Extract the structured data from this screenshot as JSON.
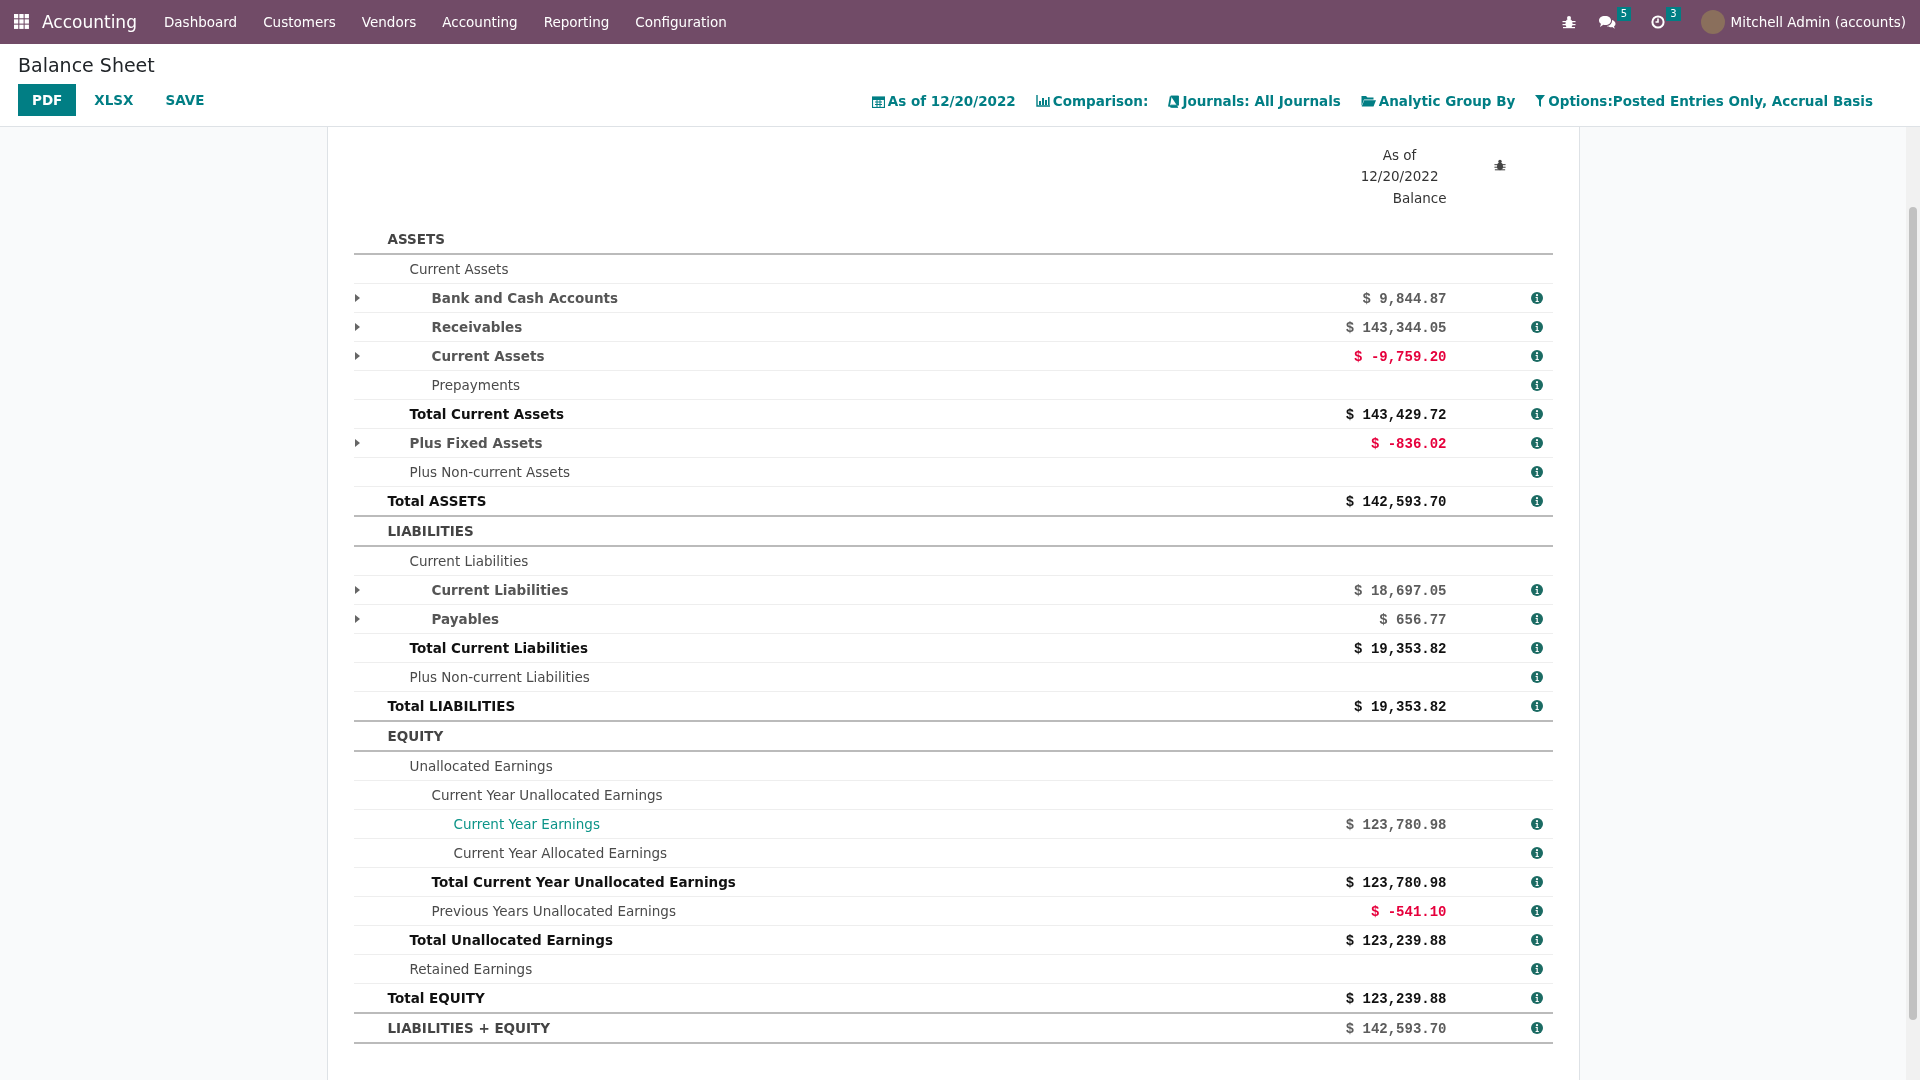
{
  "app": {
    "name": "Accounting"
  },
  "menu": [
    "Dashboard",
    "Customers",
    "Vendors",
    "Accounting",
    "Reporting",
    "Configuration"
  ],
  "systray": {
    "messages": "5",
    "activities": "3",
    "user": "Mitchell Admin (accounts)"
  },
  "page": {
    "title": "Balance Sheet"
  },
  "buttons": [
    {
      "label": "PDF",
      "kind": "primary"
    },
    {
      "label": "XLSX",
      "kind": "link"
    },
    {
      "label": "SAVE",
      "kind": "link"
    }
  ],
  "filters": [
    {
      "kind": "date",
      "label": "As of 12/20/2022"
    },
    {
      "kind": "comparison",
      "label": "Comparison:"
    },
    {
      "kind": "journals",
      "label": "Journals: All Journals"
    },
    {
      "kind": "analytic",
      "label": "Analytic Group By"
    },
    {
      "kind": "options",
      "label": "Options:Posted Entries Only, Accrual Basis"
    }
  ],
  "report": {
    "header": {
      "date": [
        "As of",
        "12/20/2022"
      ],
      "column": "Balance"
    },
    "lines": [
      {
        "kind": "section",
        "label": "ASSETS",
        "children": [
          {
            "kind": "group",
            "label": "Current Assets",
            "children": [
              {
                "kind": "account",
                "label": "Bank and Cash Accounts",
                "value": "$ 9,844.87",
                "negative": false
              },
              {
                "kind": "account",
                "label": "Receivables",
                "value": "$ 143,344.05",
                "negative": false
              },
              {
                "kind": "account",
                "label": "Current Assets",
                "value": "$ -9,759.20",
                "negative": true
              },
              {
                "kind": "line",
                "label": "Prepayments"
              }
            ]
          },
          {
            "kind": "total",
            "label": "Total Current Assets",
            "value": "$ 143,429.72",
            "negative": false
          },
          {
            "kind": "account",
            "label": "Plus Fixed Assets",
            "value": "$ -836.02",
            "negative": true
          },
          {
            "kind": "line",
            "label": "Plus Non-current Assets"
          }
        ]
      },
      {
        "kind": "grand",
        "label": "Total ASSETS",
        "value": "$ 142,593.70",
        "negative": false
      },
      {
        "kind": "section",
        "label": "LIABILITIES",
        "children": [
          {
            "kind": "group",
            "label": "Current Liabilities",
            "children": [
              {
                "kind": "account",
                "label": "Current Liabilities",
                "value": "$ 18,697.05",
                "negative": false
              },
              {
                "kind": "account",
                "label": "Payables",
                "value": "$ 656.77",
                "negative": false
              }
            ]
          },
          {
            "kind": "total",
            "label": "Total Current Liabilities",
            "value": "$ 19,353.82",
            "negative": false
          },
          {
            "kind": "line",
            "label": "Plus Non-current Liabilities"
          }
        ]
      },
      {
        "kind": "grand",
        "label": "Total LIABILITIES",
        "value": "$ 19,353.82",
        "negative": false
      },
      {
        "kind": "section",
        "label": "EQUITY",
        "children": [
          {
            "kind": "group",
            "label": "Unallocated Earnings",
            "children": [
              {
                "kind": "group",
                "label": "Current Year Unallocated Earnings",
                "children": [
                  {
                    "kind": "link",
                    "label": "Current Year Earnings",
                    "value": "$ 123,780.98",
                    "negative": false
                  },
                  {
                    "kind": "line",
                    "label": "Current Year Allocated Earnings"
                  }
                ]
              },
              {
                "kind": "total",
                "label": "Total Current Year Unallocated Earnings",
                "value": "$ 123,780.98",
                "negative": false
              },
              {
                "kind": "line",
                "label": "Previous Years Unallocated Earnings",
                "value": "$ -541.10",
                "negative": true
              }
            ]
          },
          {
            "kind": "total",
            "label": "Total Unallocated Earnings",
            "value": "$ 123,239.88",
            "negative": false
          },
          {
            "kind": "line",
            "label": "Retained Earnings"
          }
        ]
      },
      {
        "kind": "grand",
        "label": "Total EQUITY",
        "value": "$ 123,239.88",
        "negative": false
      },
      {
        "kind": "summary",
        "label": "LIABILITIES + EQUITY",
        "value": "$ 142,593.70",
        "negative": false
      }
    ]
  }
}
